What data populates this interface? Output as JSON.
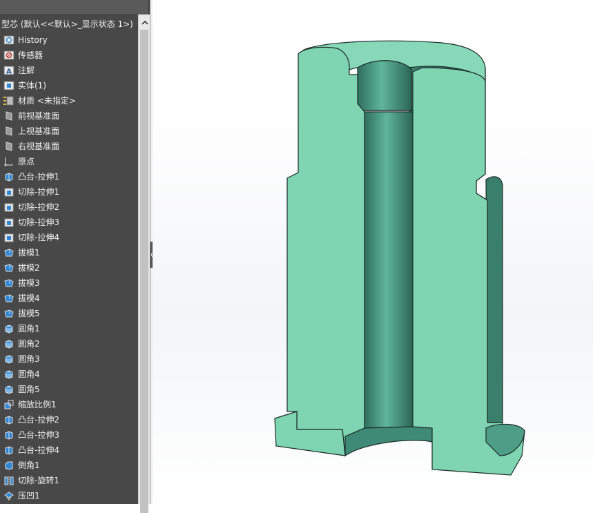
{
  "feature_tree": {
    "part_title": "型芯 (默认<<默认>_显示状态 1>)",
    "items": [
      {
        "label": "History",
        "icon": "history-icon"
      },
      {
        "label": "传感器",
        "icon": "sensor-icon"
      },
      {
        "label": "注解",
        "icon": "annotation-icon"
      },
      {
        "label": "实体(1)",
        "icon": "solid-bodies-icon"
      },
      {
        "label": "材质 <未指定>",
        "icon": "material-icon"
      },
      {
        "label": "前视基准面",
        "icon": "plane-icon"
      },
      {
        "label": "上视基准面",
        "icon": "plane-icon"
      },
      {
        "label": "右视基准面",
        "icon": "plane-icon"
      },
      {
        "label": "原点",
        "icon": "origin-icon"
      },
      {
        "label": "凸台-拉伸1",
        "icon": "boss-extrude-icon"
      },
      {
        "label": "切除-拉伸1",
        "icon": "cut-extrude-icon"
      },
      {
        "label": "切除-拉伸2",
        "icon": "cut-extrude-icon"
      },
      {
        "label": "切除-拉伸3",
        "icon": "cut-extrude-icon"
      },
      {
        "label": "切除-拉伸4",
        "icon": "cut-extrude-icon"
      },
      {
        "label": "拔模1",
        "icon": "draft-icon"
      },
      {
        "label": "拔模2",
        "icon": "draft-icon"
      },
      {
        "label": "拔模3",
        "icon": "draft-icon"
      },
      {
        "label": "拔模4",
        "icon": "draft-icon"
      },
      {
        "label": "拔模5",
        "icon": "draft-icon"
      },
      {
        "label": "圆角1",
        "icon": "fillet-icon"
      },
      {
        "label": "圆角2",
        "icon": "fillet-icon"
      },
      {
        "label": "圆角3",
        "icon": "fillet-icon"
      },
      {
        "label": "圆角4",
        "icon": "fillet-icon"
      },
      {
        "label": "圆角5",
        "icon": "fillet-icon"
      },
      {
        "label": "缩放比例1",
        "icon": "scale-icon"
      },
      {
        "label": "凸台-拉伸2",
        "icon": "boss-extrude-icon"
      },
      {
        "label": "凸台-拉伸3",
        "icon": "boss-extrude-icon"
      },
      {
        "label": "凸台-拉伸4",
        "icon": "boss-extrude-icon"
      },
      {
        "label": "倒角1",
        "icon": "chamfer-icon"
      },
      {
        "label": "切除-旋转1",
        "icon": "cut-revolve-icon"
      },
      {
        "label": "压凹1",
        "icon": "indent-icon"
      }
    ]
  },
  "colors": {
    "panel_bg": "#484848",
    "panel_text": "#f2f2f2",
    "model_face": "#7fd4b2",
    "model_face_light": "#9be3c6",
    "model_shadow": "#2f6e5f",
    "model_edge": "#1c2b27",
    "icon_blue": "#2f86d4"
  }
}
